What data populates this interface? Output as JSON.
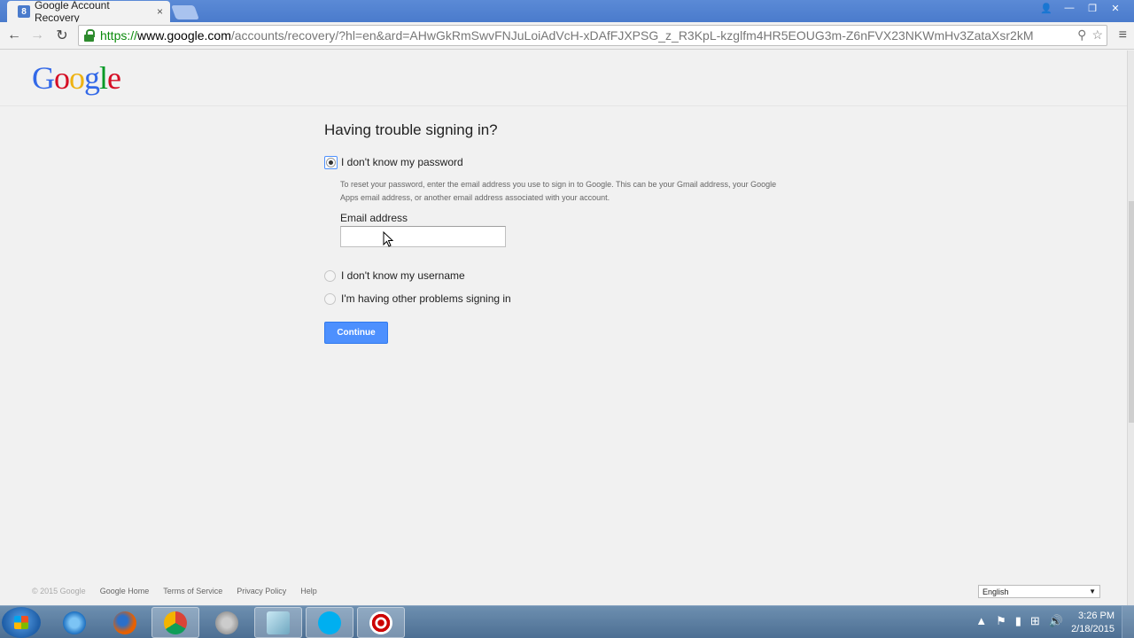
{
  "browser": {
    "tab_title": "Google Account Recovery",
    "tab_close": "×",
    "favicon_letter": "8",
    "url_scheme": "https://",
    "url_host": "www.google.com",
    "url_rest": "/accounts/recovery/?hl=en&ard=AHwGkRmSwvFNJuLoiAdVcH-xDAfFJXPSG_z_R3KpL-kzglfm4HR5EOUG3m-Z6nFVX23NKWmHv3ZataXsr2kM",
    "back_icon": "←",
    "forward_icon": "→",
    "reload_icon": "↻",
    "zoom_icon": "⚲",
    "star_icon": "☆",
    "menu_icon": "≡",
    "win_user": "👤",
    "win_min": "—",
    "win_max": "❐",
    "win_close": "✕"
  },
  "logo": {
    "G": "G",
    "o1": "o",
    "o2": "o",
    "g": "g",
    "l": "l",
    "e": "e"
  },
  "form": {
    "heading": "Having trouble signing in?",
    "option1_label": "I don't know my password",
    "help_text": "To reset your password, enter the email address you use to sign in to Google. This can be your Gmail address, your Google Apps email address, or another email address associated with your account.",
    "email_label": "Email address",
    "email_value": "",
    "option2_label": "I don't know my username",
    "option3_label": "I'm having other problems signing in",
    "continue_label": "Continue"
  },
  "footer": {
    "copyright": "© 2015 Google",
    "links": [
      "Google Home",
      "Terms of Service",
      "Privacy Policy",
      "Help"
    ],
    "language": "English",
    "language_caret": "▼"
  },
  "taskbar": {
    "clock_time": "3:26 PM",
    "clock_date": "2/18/2015",
    "tray_up": "▲",
    "tray_flag": "⚑",
    "tray_battery": "▮",
    "tray_network": "⊞",
    "tray_volume": "🔊"
  },
  "colors": {
    "accent": "#4d90fe",
    "google_blue": "#3369e8",
    "google_red": "#d50f25",
    "google_yellow": "#eeb211",
    "google_green": "#009925"
  }
}
